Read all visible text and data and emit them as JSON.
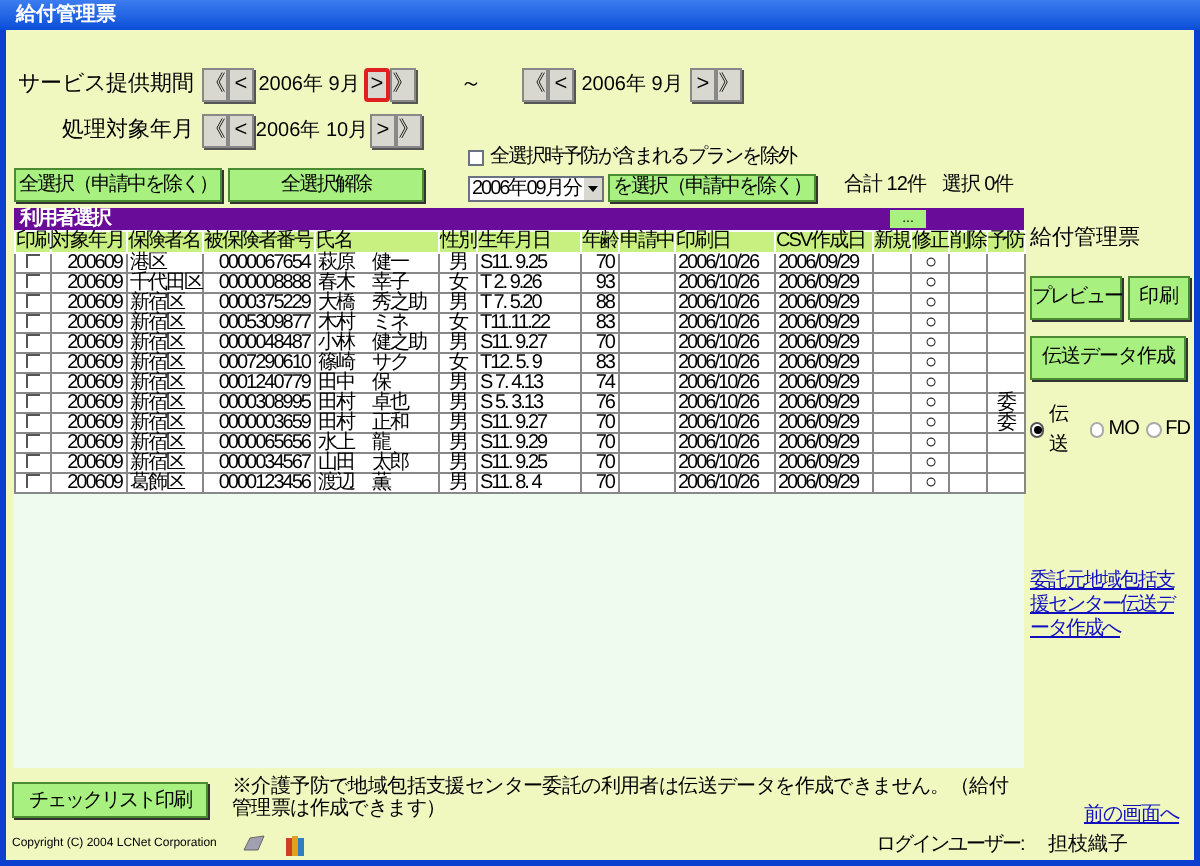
{
  "window": {
    "title": "給付管理票"
  },
  "service_period": {
    "label": "サービス提供期間",
    "from": {
      "value": "2006年 9月",
      "buttons": [
        {
          "label": "《",
          "highlighted": false
        },
        {
          "label": "<",
          "highlighted": false
        },
        {
          "label": ">",
          "highlighted": true
        },
        {
          "label": "》",
          "highlighted": false
        }
      ]
    },
    "separator": "～",
    "to": {
      "value": "2006年 9月",
      "buttons": [
        {
          "label": "《",
          "highlighted": false
        },
        {
          "label": "<",
          "highlighted": false
        },
        {
          "label": ">",
          "highlighted": false
        },
        {
          "label": "》",
          "highlighted": false
        }
      ]
    }
  },
  "process_month": {
    "label": "処理対象年月",
    "value": "2006年 10月",
    "buttons": [
      {
        "label": "《",
        "highlighted": false
      },
      {
        "label": "<",
        "highlighted": false
      },
      {
        "label": ">",
        "highlighted": false
      },
      {
        "label": "》",
        "highlighted": false
      }
    ]
  },
  "select_all_button": "全選択（申請中を除く）",
  "deselect_all_button": "全選択解除",
  "exclude_checkbox": {
    "label": "全選択時予防が含まれるプランを除外",
    "checked": false
  },
  "month_select": {
    "value": "2006年09月分"
  },
  "select_month_button": "を選択（申請中を除く）",
  "total": "合計 12件",
  "selected_count": "選択 0件",
  "panel": {
    "title": "利用者選択",
    "more_button": "..."
  },
  "table": {
    "columns": [
      "印刷",
      "対象年月",
      "保険者名",
      "被保険者番号",
      "氏名",
      "性別",
      "生年月日",
      "年齢",
      "申請中",
      "印刷日",
      "CSV作成日",
      "新規",
      "修正",
      "削除",
      "予防"
    ],
    "rows": [
      {
        "checked": false,
        "cells": [
          "",
          "200609",
          "港区",
          "0000067654",
          "萩原　健一",
          "男",
          "S11. 9.25",
          "70",
          "",
          "2006/10/26",
          "2006/09/29",
          "",
          "○",
          "",
          ""
        ]
      },
      {
        "checked": false,
        "cells": [
          "",
          "200609",
          "千代田区",
          "0000008888",
          "春木　幸子",
          "女",
          "T 2. 9.26",
          "93",
          "",
          "2006/10/26",
          "2006/09/29",
          "",
          "○",
          "",
          ""
        ]
      },
      {
        "checked": false,
        "cells": [
          "",
          "200609",
          "新宿区",
          "0000375229",
          "大橋　秀之助",
          "男",
          "T 7. 5.20",
          "88",
          "",
          "2006/10/26",
          "2006/09/29",
          "",
          "○",
          "",
          ""
        ]
      },
      {
        "checked": false,
        "cells": [
          "",
          "200609",
          "新宿区",
          "0005309877",
          "木村　ミネ",
          "女",
          "T11.11.22",
          "83",
          "",
          "2006/10/26",
          "2006/09/29",
          "",
          "○",
          "",
          ""
        ]
      },
      {
        "checked": false,
        "cells": [
          "",
          "200609",
          "新宿区",
          "0000048487",
          "小林　健之助",
          "男",
          "S11. 9.27",
          "70",
          "",
          "2006/10/26",
          "2006/09/29",
          "",
          "○",
          "",
          ""
        ]
      },
      {
        "checked": false,
        "cells": [
          "",
          "200609",
          "新宿区",
          "0007290610",
          "篠崎　サク",
          "女",
          "T12. 5. 9",
          "83",
          "",
          "2006/10/26",
          "2006/09/29",
          "",
          "○",
          "",
          ""
        ]
      },
      {
        "checked": false,
        "cells": [
          "",
          "200609",
          "新宿区",
          "0001240779",
          "田中　保",
          "男",
          "S 7. 4.13",
          "74",
          "",
          "2006/10/26",
          "2006/09/29",
          "",
          "○",
          "",
          ""
        ]
      },
      {
        "checked": false,
        "cells": [
          "",
          "200609",
          "新宿区",
          "0000308995",
          "田村　卓也",
          "男",
          "S 5. 3.13",
          "76",
          "",
          "2006/10/26",
          "2006/09/29",
          "",
          "○",
          "",
          "委"
        ]
      },
      {
        "checked": false,
        "cells": [
          "",
          "200609",
          "新宿区",
          "0000003659",
          "田村　正和",
          "男",
          "S11. 9.27",
          "70",
          "",
          "2006/10/26",
          "2006/09/29",
          "",
          "○",
          "",
          "委"
        ]
      },
      {
        "checked": false,
        "cells": [
          "",
          "200609",
          "新宿区",
          "0000065656",
          "水上　龍",
          "男",
          "S11. 9.29",
          "70",
          "",
          "2006/10/26",
          "2006/09/29",
          "",
          "○",
          "",
          ""
        ]
      },
      {
        "checked": false,
        "cells": [
          "",
          "200609",
          "新宿区",
          "0000034567",
          "山田　太郎",
          "男",
          "S11. 9.25",
          "70",
          "",
          "2006/10/26",
          "2006/09/29",
          "",
          "○",
          "",
          ""
        ]
      },
      {
        "checked": false,
        "cells": [
          "",
          "200609",
          "葛飾区",
          "0000123456",
          "渡辺　薫",
          "男",
          "S11. 8. 4",
          "70",
          "",
          "2006/10/26",
          "2006/09/29",
          "",
          "○",
          "",
          ""
        ]
      }
    ]
  },
  "side": {
    "title": "給付管理票",
    "preview_button": "プレビュー",
    "print_button": "印刷",
    "transfer_button": "伝送データ作成",
    "media": [
      {
        "label": "伝送",
        "selected": true
      },
      {
        "label": "MO",
        "selected": false
      },
      {
        "label": "FD",
        "selected": false
      }
    ],
    "link": "委託元地域包括支援センター伝送データ作成へ"
  },
  "checklist_button": "チェックリスト印刷",
  "note": "※介護予防で地域包括支援センター委託の利用者は伝送データを作成できません。（給付管理票は作成できます）",
  "back_link": "前の画面へ",
  "footer": {
    "copyright": "Copyright (C) 2004 LCNet Corporation",
    "login_label": "ログインユーザー:",
    "user": "担枝織子"
  }
}
